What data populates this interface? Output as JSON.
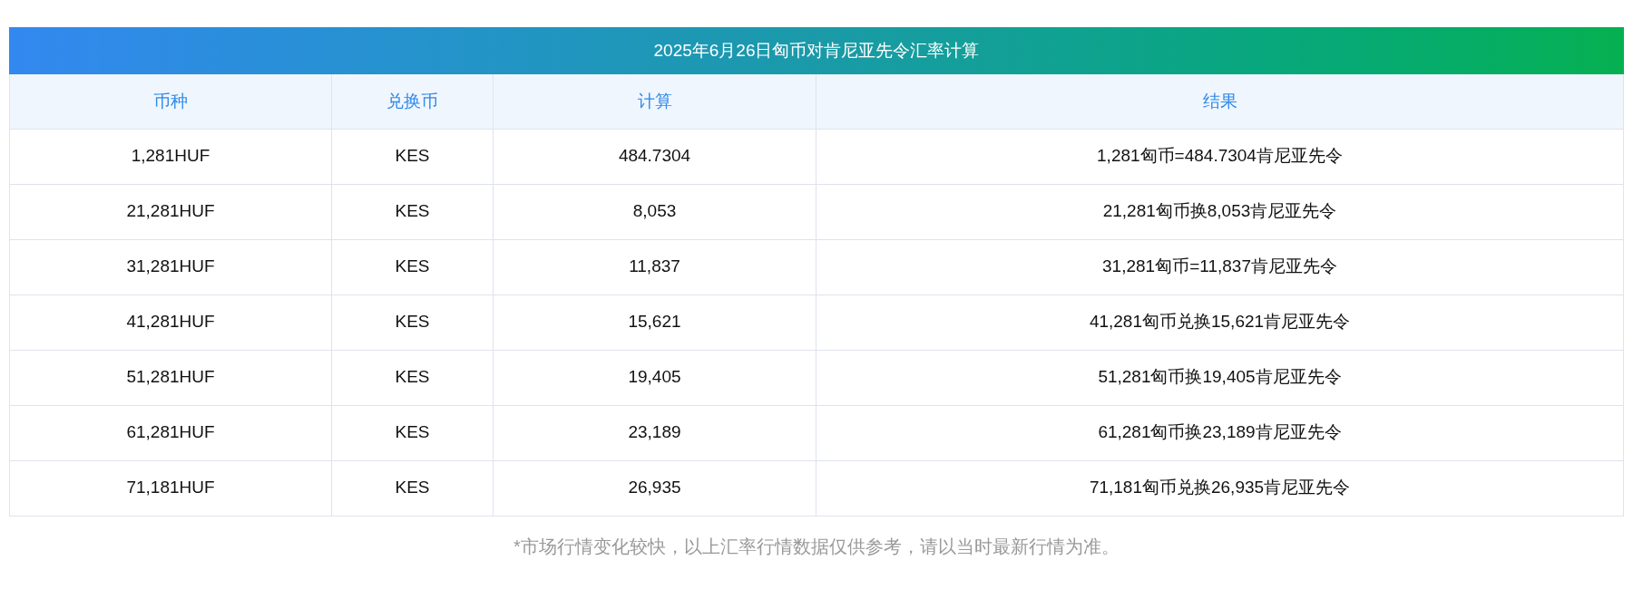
{
  "title": "2025年6月26日匈币对肯尼亚先令汇率计算",
  "table": {
    "columns": [
      "币种",
      "兑换币",
      "计算",
      "结果"
    ],
    "rows": [
      [
        "1,281HUF",
        "KES",
        "484.7304",
        "1,281匈币=484.7304肯尼亚先令"
      ],
      [
        "21,281HUF",
        "KES",
        "8,053",
        "21,281匈币换8,053肯尼亚先令"
      ],
      [
        "31,281HUF",
        "KES",
        "11,837",
        "31,281匈币=11,837肯尼亚先令"
      ],
      [
        "41,281HUF",
        "KES",
        "15,621",
        "41,281匈币兑换15,621肯尼亚先令"
      ],
      [
        "51,281HUF",
        "KES",
        "19,405",
        "51,281匈币换19,405肯尼亚先令"
      ],
      [
        "61,281HUF",
        "KES",
        "23,189",
        "61,281匈币换23,189肯尼亚先令"
      ],
      [
        "71,181HUF",
        "KES",
        "26,935",
        "71,181匈币兑换26,935肯尼亚先令"
      ]
    ]
  },
  "note": "*市场行情变化较快，以上汇率行情数据仅供参考，请以当时最新行情为准。"
}
